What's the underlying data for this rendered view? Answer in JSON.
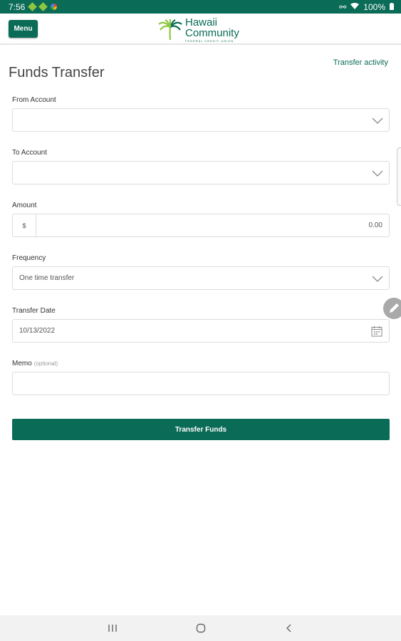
{
  "status_bar": {
    "time": "7:56",
    "battery": "100%"
  },
  "header": {
    "menu_label": "Menu",
    "logo_line1": "Hawaii",
    "logo_line2": "Community",
    "logo_line3": "FEDERAL CREDIT UNION"
  },
  "page": {
    "title": "Funds Transfer",
    "activity_link": "Transfer activity"
  },
  "form": {
    "from_account": {
      "label": "From Account",
      "value": ""
    },
    "to_account": {
      "label": "To Account",
      "value": ""
    },
    "amount": {
      "label": "Amount",
      "currency": "$",
      "placeholder": "0.00"
    },
    "frequency": {
      "label": "Frequency",
      "value": "One time transfer"
    },
    "transfer_date": {
      "label": "Transfer Date",
      "value": "10/13/2022"
    },
    "memo": {
      "label": "Memo",
      "optional": "(optional)",
      "value": ""
    },
    "submit_label": "Transfer Funds"
  },
  "colors": {
    "brand": "#0a6b56",
    "accent": "#8fc63f"
  }
}
